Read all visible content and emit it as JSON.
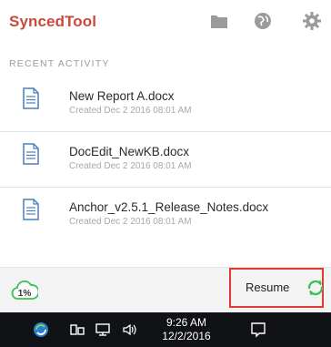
{
  "header": {
    "title": "SyncedTool",
    "icons": [
      "folder-icon",
      "globe-icon",
      "gear-icon"
    ]
  },
  "section_label": "RECENT ACTIVITY",
  "items": [
    {
      "name": "New Report A.docx",
      "meta": "Created Dec 2 2016 08:01 AM"
    },
    {
      "name": "DocEdit_NewKB.docx",
      "meta": "Created Dec 2 2016 08:01 AM"
    },
    {
      "name": "Anchor_v2.5.1_Release_Notes.docx",
      "meta": "Created Dec 2 2016 08:01 AM"
    }
  ],
  "footer": {
    "usage_label": "1%",
    "resume_label": "Resume"
  },
  "taskbar": {
    "time": "9:26 AM",
    "date": "12/2/2016"
  },
  "colors": {
    "brand": "#c94a3a",
    "highlight_border": "#e53935",
    "sync_green": "#3fbf5a",
    "icon_gray": "#9b9b9b",
    "doc_blue": "#4a7fc1"
  }
}
